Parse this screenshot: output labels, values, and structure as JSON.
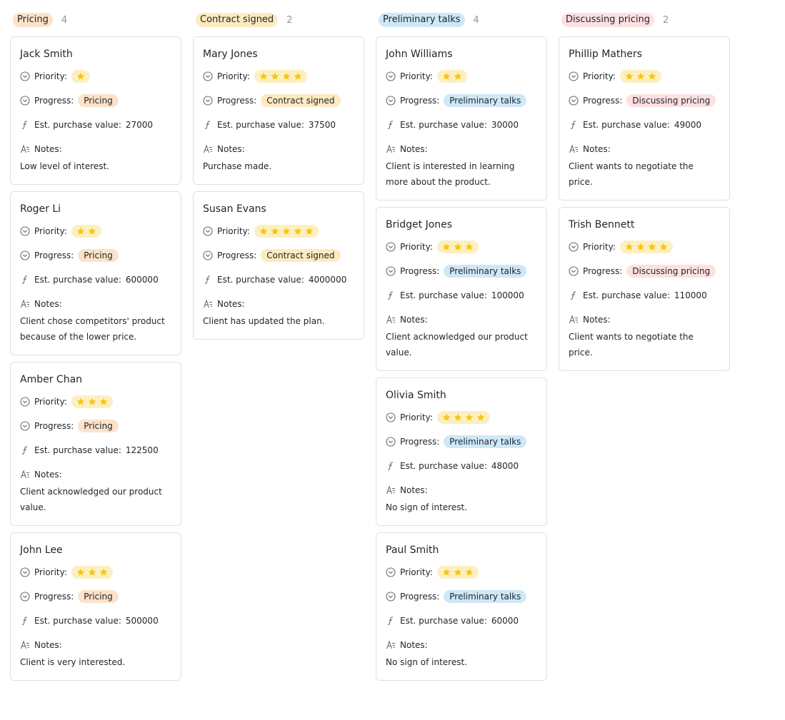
{
  "labels": {
    "priority": "Priority:",
    "progress": "Progress:",
    "value": "Est. purchase value:",
    "notes": "Notes:"
  },
  "colors": {
    "Pricing": "#fde2c9",
    "Contract signed": "#fdeac0",
    "Preliminary talks": "#cfe8f7",
    "Discussing pricing": "#fde0e0",
    "star": "#f9c50d"
  },
  "columns": [
    {
      "title": "Pricing",
      "count": "4",
      "cards": [
        {
          "name": "Jack Smith",
          "stars": 1,
          "progress": "Pricing",
          "value": "27000",
          "notes": "Low level of interest."
        },
        {
          "name": "Roger Li",
          "stars": 2,
          "progress": "Pricing",
          "value": "600000",
          "notes": "Client chose competitors' product because of the lower price."
        },
        {
          "name": "Amber Chan",
          "stars": 3,
          "progress": "Pricing",
          "value": "122500",
          "notes": "Client acknowledged our product value."
        },
        {
          "name": "John Lee",
          "stars": 3,
          "progress": "Pricing",
          "value": "500000",
          "notes": "Client is very interested."
        }
      ]
    },
    {
      "title": "Contract signed",
      "count": "2",
      "cards": [
        {
          "name": "Mary Jones",
          "stars": 4,
          "progress": "Contract signed",
          "value": "37500",
          "notes": "Purchase made."
        },
        {
          "name": "Susan Evans",
          "stars": 5,
          "progress": "Contract signed",
          "value": "4000000",
          "notes": "Client has updated the plan."
        }
      ]
    },
    {
      "title": "Preliminary talks",
      "count": "4",
      "cards": [
        {
          "name": "John Williams",
          "stars": 2,
          "progress": "Preliminary talks",
          "value": "30000",
          "notes": "Client is interested in learning more about the product."
        },
        {
          "name": "Bridget Jones",
          "stars": 3,
          "progress": "Preliminary talks",
          "value": "100000",
          "notes": "Client acknowledged our product value."
        },
        {
          "name": "Olivia Smith",
          "stars": 4,
          "progress": "Preliminary talks",
          "value": "48000",
          "notes": "No sign of interest."
        },
        {
          "name": "Paul Smith",
          "stars": 3,
          "progress": "Preliminary talks",
          "value": "60000",
          "notes": "No sign of interest."
        }
      ]
    },
    {
      "title": "Discussing pricing",
      "count": "2",
      "cards": [
        {
          "name": "Phillip Mathers",
          "stars": 3,
          "progress": "Discussing pricing",
          "value": "49000",
          "notes": "Client wants to negotiate the price."
        },
        {
          "name": "Trish Bennett",
          "stars": 4,
          "progress": "Discussing pricing",
          "value": "110000",
          "notes": "Client wants to negotiate the price."
        }
      ]
    }
  ]
}
